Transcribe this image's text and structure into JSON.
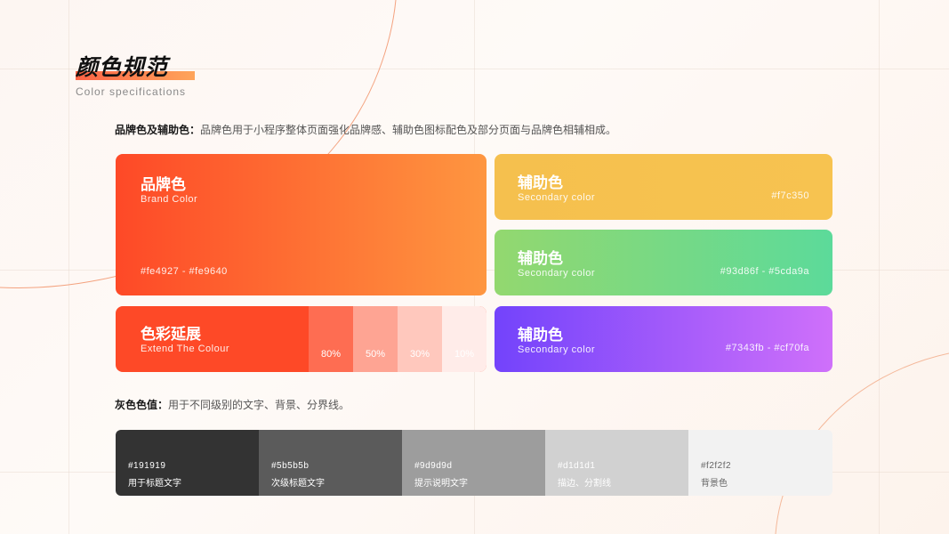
{
  "page": {
    "title": "颜色规范",
    "subtitle": "Color specifications"
  },
  "brand_section": {
    "label": "品牌色及辅助色：",
    "description": "品牌色用于小程序整体页面强化品牌感、辅助色图标配色及部分页面与品牌色相辅相成。"
  },
  "brand_card": {
    "name": "品牌色",
    "en": "Brand Color",
    "hex": "#fe4927 - #fe9640",
    "colors": [
      "#fe4927",
      "#fe9640"
    ]
  },
  "extend_card": {
    "name": "色彩延展",
    "en": "Extend The Colour",
    "base_color": "#fe4927",
    "tints": [
      {
        "label": "80%",
        "color": "#fe6d52"
      },
      {
        "label": "50%",
        "color": "#fea493"
      },
      {
        "label": "30%",
        "color": "#ffc8bd"
      },
      {
        "label": "10%",
        "color": "#ffece9"
      }
    ]
  },
  "secondary_cards": [
    {
      "name": "辅助色",
      "en": "Secondary color",
      "hex": "#f7c350",
      "colors": [
        "#f5c04e",
        "#f7c350"
      ]
    },
    {
      "name": "辅助色",
      "en": "Secondary color",
      "hex": "#93d86f - #5cda9a",
      "colors": [
        "#93d86f",
        "#5cda9a"
      ]
    },
    {
      "name": "辅助色",
      "en": "Secondary color",
      "hex": "#7343fb - #cf70fa",
      "colors": [
        "#7343fb",
        "#cf70fa"
      ]
    }
  ],
  "gray_section": {
    "label": "灰色色值：",
    "description": "用于不同级别的文字、背景、分界线。"
  },
  "grays": [
    {
      "hex": "#191919",
      "label": "用于标题文字",
      "color": "#333333",
      "text_color": "#ffffff"
    },
    {
      "hex": "#5b5b5b",
      "label": "次级标题文字",
      "color": "#5b5b5b",
      "text_color": "#ffffff"
    },
    {
      "hex": "#9d9d9d",
      "label": "提示说明文字",
      "color": "#9d9d9d",
      "text_color": "#ffffff"
    },
    {
      "hex": "#d1d1d1",
      "label": "描边、分割线",
      "color": "#d1d1d1",
      "text_color": "#ffffff"
    },
    {
      "hex": "#f2f2f2",
      "label": "背景色",
      "color": "#f2f2f2",
      "text_color": "#666666"
    }
  ]
}
